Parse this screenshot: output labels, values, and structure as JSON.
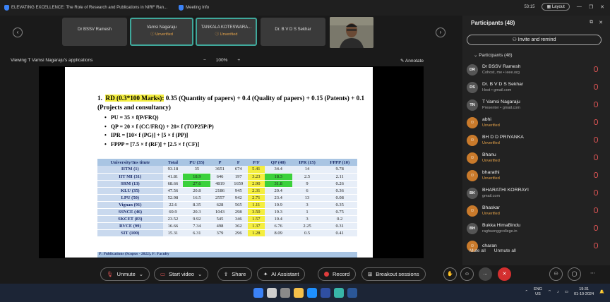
{
  "window": {
    "tab_title": "ELEVATING EXCELLENCE: The Role of Research and Publications in NIRF Ran...",
    "meeting_info": "Meeting Info",
    "timer": "53:15",
    "layout_label": "Layout"
  },
  "strip": {
    "tiles": [
      {
        "name": "Dr BSSV Ramesh",
        "status": ""
      },
      {
        "name": "Vamsi Nagaraju",
        "status": "Unverified"
      },
      {
        "name": "TANKALA KOTESWARA...",
        "status": "Unverified"
      },
      {
        "name": "Dr. B V D S Sekhar",
        "status": ""
      }
    ]
  },
  "viewbar": {
    "viewing_label": "Viewing T Vamsi Nagaraju's applications",
    "zoom_minus": "−",
    "zoom_level": "100%",
    "zoom_plus": "+",
    "annotate": "Annotate"
  },
  "slide": {
    "heading_num": "1.",
    "heading_hl": "RD (0.3*100 Marks):",
    "heading_rest": "0.35 (Quantity of papers) + 0.4 (Quality of papers) + 0.15 (Patents) + 0.1 (Projects and consultancy)",
    "bullets": [
      "PU = 35 × f(P/FRQ)",
      "QP = 20 × f (CC/FRQ) + 20× f (TOP25P/P)",
      "IPR = [10× f (PG)] + [5 × f (PP)]",
      "FPPP = [7.5 × f (RF)] + [2.5 × f (CF)]"
    ],
    "headers": [
      "University/Ins titute",
      "Total",
      "PU (35)",
      "P",
      "F",
      "P/F",
      "QP (40)",
      "IPR (15)",
      "FPPP (10)"
    ],
    "rows": [
      [
        "IITM (1)",
        "93.18",
        "35",
        "3651",
        "674",
        "5.41",
        "34.4",
        "14",
        "9.78"
      ],
      [
        "IIT MI (31)",
        "41.81",
        "18.9",
        "646",
        "197",
        "3.23",
        "18.3",
        "2.5",
        "2.11"
      ],
      [
        "SRM (13)",
        "68.66",
        "27.6",
        "4819",
        "1659",
        "2.90",
        "31.8",
        "9",
        "0.26"
      ],
      [
        "KLU (35)",
        "47.56",
        "20.8",
        "2186",
        "945",
        "2.31",
        "20.4",
        "6",
        "0.36"
      ],
      [
        "LPU (50)",
        "52.98",
        "16.5",
        "2557",
        "942",
        "2.71",
        "23.4",
        "13",
        "0.08"
      ],
      [
        "Vignan (91)",
        "22.6",
        "8.35",
        "628",
        "565",
        "1.11",
        "10.9",
        "3",
        "0.35"
      ],
      [
        "SSNCE (46)",
        "69.9",
        "20.3",
        "1043",
        "298",
        "3.50",
        "19.3",
        "1",
        "0.75"
      ],
      [
        "SKCET (83)",
        "23.52",
        "9.92",
        "545",
        "346",
        "1.57",
        "10.4",
        "3",
        "0.2"
      ],
      [
        "RVCE (99)",
        "16.66",
        "7.34",
        "498",
        "362",
        "1.37",
        "6.76",
        "2.25",
        "0.31"
      ],
      [
        "SIT (100)",
        "15.31",
        "6.31",
        "379",
        "296",
        "1.28",
        "8.09",
        "0.5",
        "0.41"
      ]
    ],
    "footer": "P: Publications (Scopus - 2022), F: Faculty"
  },
  "panel": {
    "title": "Participants (48)",
    "invite": "Invite and remind",
    "section": "Participants (48)",
    "participants": [
      {
        "initials": "DR",
        "name": "Dr BSSV Ramesh",
        "sub": "Cohost, me • ieee.org",
        "unverified": false
      },
      {
        "initials": "DS",
        "name": "Dr. B V D S Sekhar",
        "sub": "Host • gmail.com",
        "unverified": false
      },
      {
        "initials": "TN",
        "name": "T Vamsi Nagaraju",
        "sub": "Presenter • gmail.com",
        "unverified": false
      },
      {
        "initials": "",
        "name": "abhi",
        "sub": "Unverified",
        "unverified": true
      },
      {
        "initials": "",
        "name": "BH D D PRIYANKA",
        "sub": "Unverified",
        "unverified": true
      },
      {
        "initials": "",
        "name": "Bhanu",
        "sub": "Unverified",
        "unverified": true
      },
      {
        "initials": "",
        "name": "bharathi",
        "sub": "Unverified",
        "unverified": true
      },
      {
        "initials": "BK",
        "name": "BHARATHI KORRAYI",
        "sub": "gmail.com",
        "unverified": false
      },
      {
        "initials": "",
        "name": "Bhaskar",
        "sub": "Unverified",
        "unverified": true
      },
      {
        "initials": "BH",
        "name": "Bukka HimaBindu",
        "sub": "raghuenggcollege.in",
        "unverified": false
      },
      {
        "initials": "",
        "name": "charan",
        "sub": "",
        "unverified": true
      }
    ],
    "mute_all": "Mute all",
    "unmute_all": "Unmute all"
  },
  "toolbar": {
    "unmute": "Unmute",
    "start_video": "Start video",
    "share": "Share",
    "ai": "AI Assistant",
    "record": "Record",
    "breakout": "Breakout sessions",
    "more": "...",
    "end": "✕"
  },
  "tray": {
    "lang": "ENG",
    "region": "US",
    "time": "19:31",
    "date": "01-10-2024"
  },
  "colors": {
    "accent_teal": "#3fa89b",
    "highlight_yellow": "#f4ee3f",
    "highlight_green": "#3bd13b",
    "end_red": "#d32f2f"
  }
}
